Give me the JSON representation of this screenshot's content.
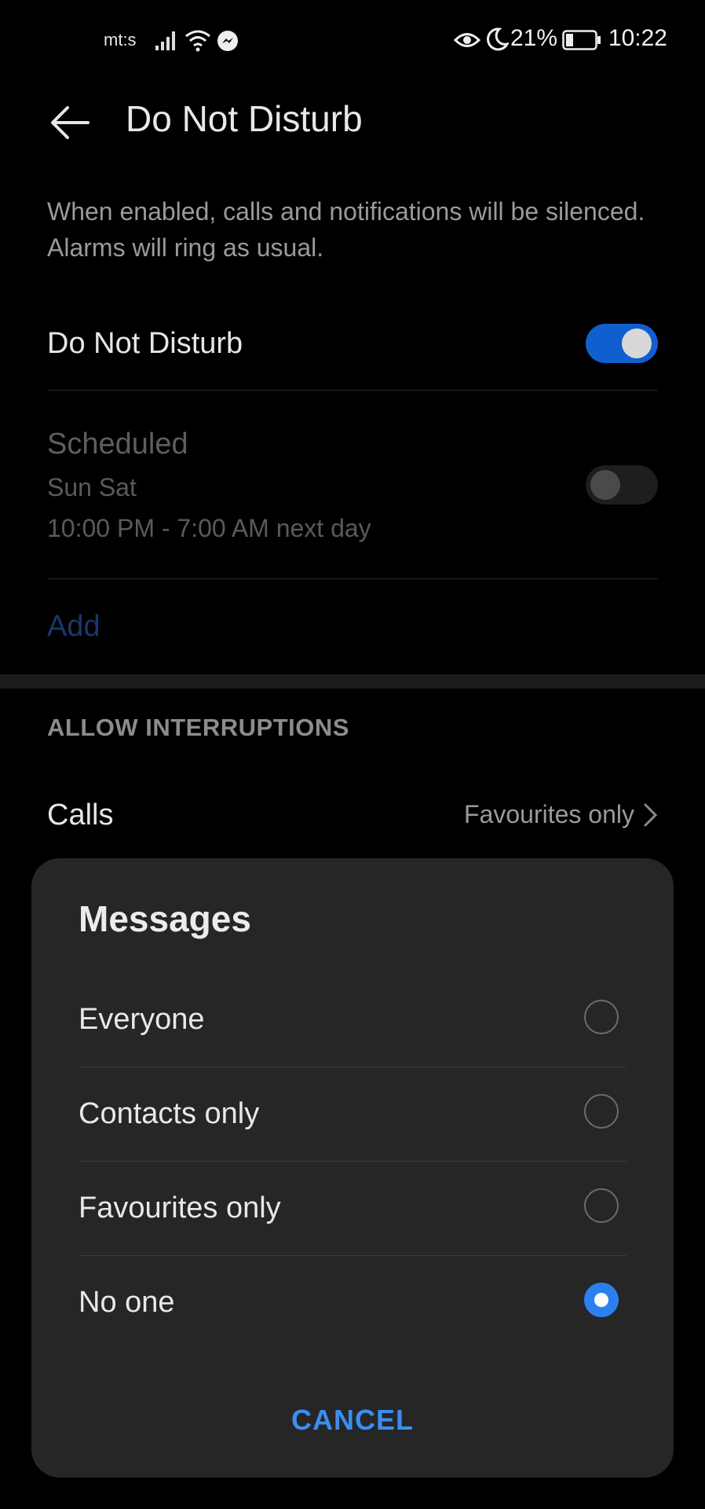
{
  "status_bar": {
    "carrier": "mt:s",
    "battery_pct": "21%",
    "time": "10:22",
    "icons": [
      "signal-icon",
      "wifi-icon",
      "messenger-icon",
      "eye-icon",
      "moon-icon",
      "battery-icon"
    ]
  },
  "header": {
    "title": "Do Not Disturb"
  },
  "description": "When enabled, calls and notifications will be silenced. Alarms will ring as usual.",
  "dnd_toggle": {
    "label": "Do Not Disturb",
    "enabled": true
  },
  "schedule": {
    "title": "Scheduled",
    "days": "Sun Sat",
    "time_range": "10:00 PM - 7:00 AM next day",
    "enabled": false
  },
  "add_label": "Add",
  "allow_interruptions": {
    "heading": "ALLOW INTERRUPTIONS",
    "calls_label": "Calls",
    "calls_value": "Favourites only"
  },
  "dialog": {
    "title": "Messages",
    "options": [
      {
        "label": "Everyone",
        "selected": false
      },
      {
        "label": "Contacts only",
        "selected": false
      },
      {
        "label": "Favourites only",
        "selected": false
      },
      {
        "label": "No one",
        "selected": true
      }
    ],
    "cancel_label": "CANCEL"
  },
  "colors": {
    "accent": "#2b80f0",
    "background": "#000000",
    "dialog": "#262626"
  }
}
